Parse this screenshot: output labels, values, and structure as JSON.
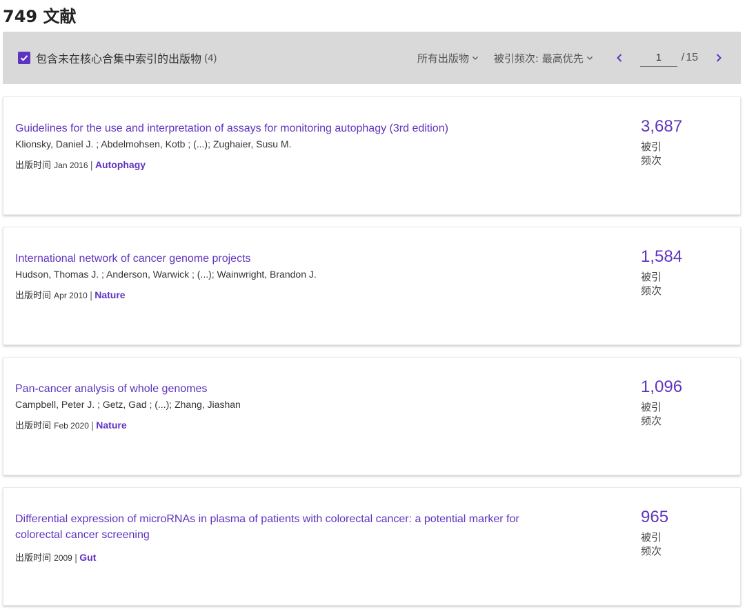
{
  "header": {
    "results_title": "749 文献"
  },
  "toolbar": {
    "checkbox_label": "包含未在核心合集中索引的出版物",
    "checkbox_count": "(4)",
    "checkbox_checked": true,
    "publications_filter": "所有出版物",
    "sort_label": "被引频次: 最高优先",
    "page_current": "1",
    "page_separator": "/",
    "page_total": "15"
  },
  "colors": {
    "accent": "#5e33bf",
    "toolbar_bg": "#d9d9d9"
  },
  "records": [
    {
      "title": "Guidelines for the use and interpretation of assays for monitoring autophagy (3rd edition)",
      "authors": "Klionsky, Daniel J. ; Abdelmohsen, Kotb ; (...); Zughaier, Susu M.",
      "pub_label": "出版时间",
      "pub_date": "Jan 2016",
      "journal": "Autophagy",
      "citations": "3,687",
      "citations_label": "被引频次"
    },
    {
      "title": "International network of cancer genome projects",
      "authors": "Hudson, Thomas J. ; Anderson, Warwick ; (...); Wainwright, Brandon J.",
      "pub_label": "出版时间",
      "pub_date": "Apr 2010",
      "journal": "Nature",
      "citations": "1,584",
      "citations_label": "被引频次"
    },
    {
      "title": "Pan-cancer analysis of whole genomes",
      "authors": "Campbell, Peter J. ; Getz, Gad ; (...); Zhang, Jiashan",
      "pub_label": "出版时间",
      "pub_date": "Feb 2020",
      "journal": "Nature",
      "citations": "1,096",
      "citations_label": "被引频次"
    },
    {
      "title": "Differential expression of microRNAs in plasma of patients with colorectal cancer: a potential marker for colorectal cancer screening",
      "authors": "",
      "pub_label": "出版时间",
      "pub_date": "2009",
      "journal": "Gut",
      "citations": "965",
      "citations_label": "被引频次"
    }
  ]
}
